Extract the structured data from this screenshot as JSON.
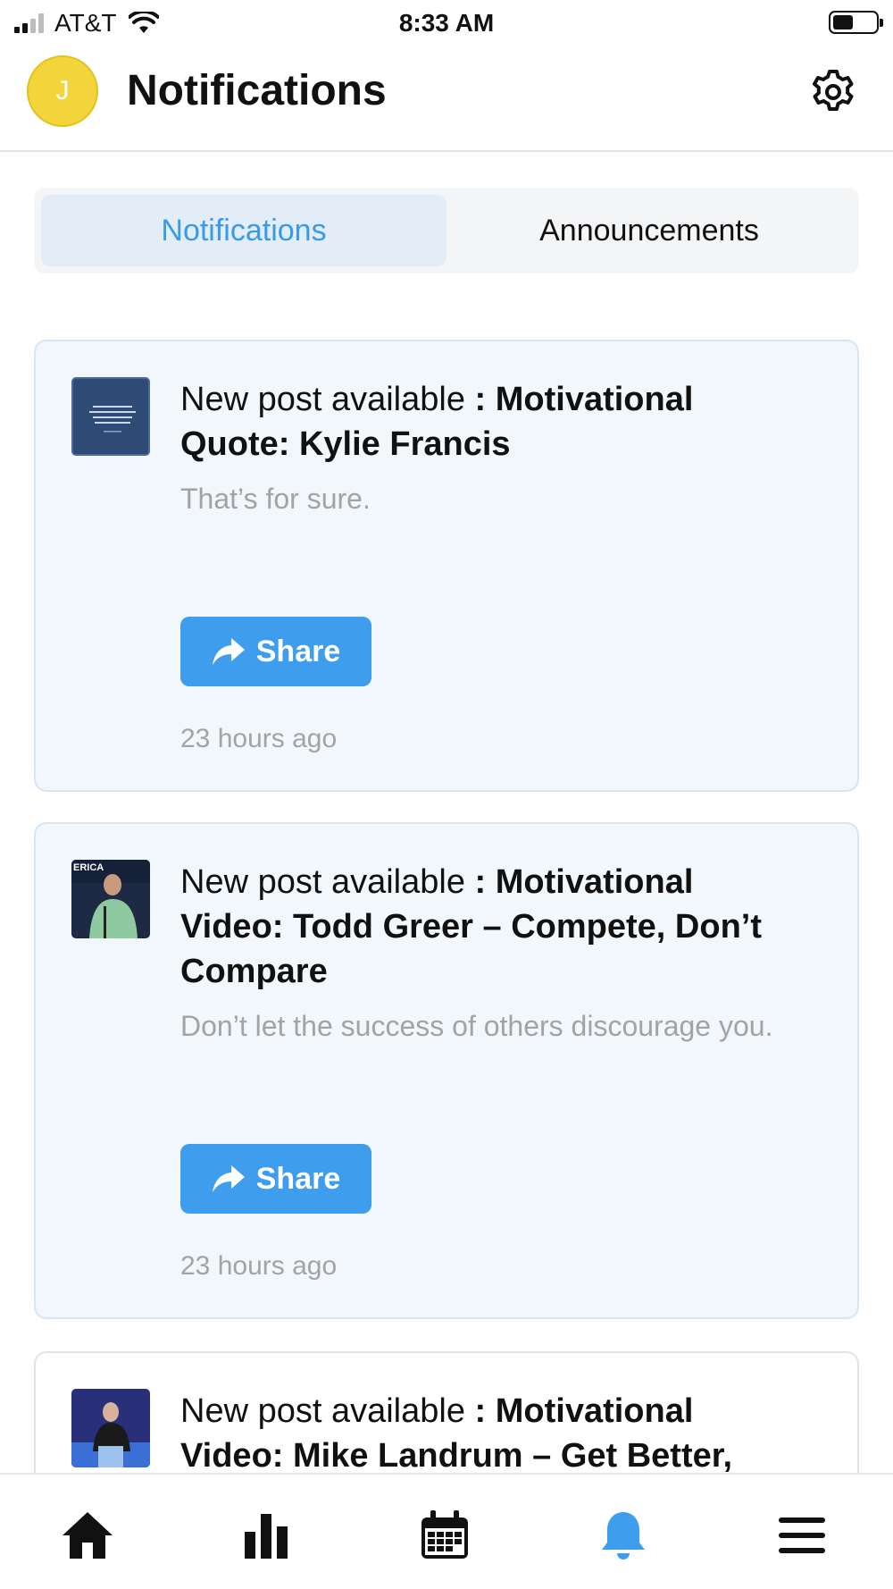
{
  "status_bar": {
    "carrier": "AT&T",
    "time": "8:33 AM",
    "signal_bars_active": 2,
    "signal_bars_total": 4,
    "battery_level": 0.45,
    "icons": [
      "signal-icon",
      "wifi-icon",
      "battery-icon"
    ]
  },
  "header": {
    "avatar_initial": "J",
    "avatar_color": "#f3d43a",
    "title": "Notifications",
    "settings_icon": "gear-icon"
  },
  "tabs": [
    {
      "label": "Notifications",
      "active": true
    },
    {
      "label": "Announcements",
      "active": false
    }
  ],
  "accent_color": "#3e9ded",
  "notifications": [
    {
      "prefix": "New post available",
      "title": ": Motivational Quote: Kylie Francis",
      "description": "That’s for sure.",
      "share_label": "Share",
      "time": "23 hours ago",
      "thumbnail": "quote-image"
    },
    {
      "prefix": "New post available",
      "title": ": Motivational Video: Todd Greer – Compete, Don’t Compare",
      "description": "Don’t let the success of others discourage you.",
      "share_label": "Share",
      "time": "23 hours ago",
      "thumbnail": "video-speaker-image",
      "thumbnail_caption": "ERICA"
    },
    {
      "prefix": "New post available",
      "title": ": Motivational Video: Mike Landrum – Get Better,",
      "thumbnail": "video-stage-image"
    }
  ],
  "bottom_nav": [
    {
      "icon": "home-icon",
      "active": false
    },
    {
      "icon": "bar-chart-icon",
      "active": false
    },
    {
      "icon": "calendar-icon",
      "active": false
    },
    {
      "icon": "bell-icon",
      "active": true
    },
    {
      "icon": "menu-icon",
      "active": false
    }
  ]
}
